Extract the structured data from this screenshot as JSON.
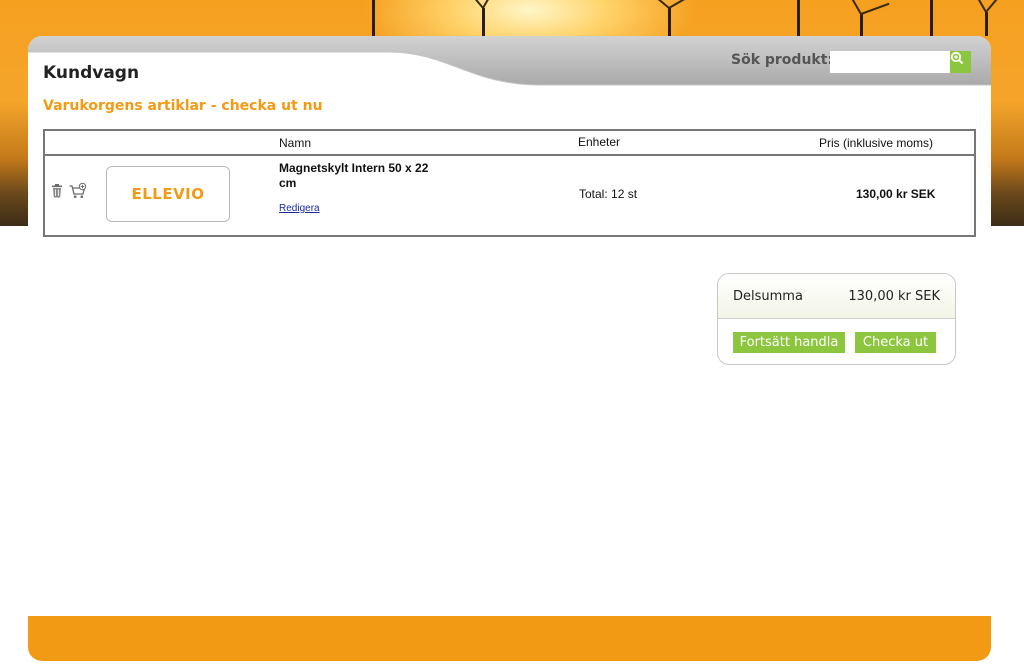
{
  "header": {
    "title": "Kundvagn",
    "search_label": "Sök produkt:",
    "search_value": ""
  },
  "cart": {
    "heading": "Varukorgens artiklar - checka ut nu",
    "columns": {
      "name": "Namn",
      "units": "Enheter",
      "price": "Pris (inklusive moms)"
    },
    "items": [
      {
        "name": "Magnetskylt Intern 50 x 22 cm",
        "edit_label": "Redigera",
        "quantity": "Total: 12 st",
        "price": "130,00 kr SEK",
        "thumbnail_logo": "ELLEVIO",
        "icons": [
          "trash-icon",
          "cart-add-icon"
        ]
      }
    ]
  },
  "summary": {
    "subtotal_label": "Delsumma",
    "subtotal_value": "130,00 kr SEK",
    "continue_label": "Fortsätt handla",
    "checkout_label": "Checka ut"
  },
  "colors": {
    "accent_orange": "#f39a14",
    "button_green": "#8cc63f"
  }
}
